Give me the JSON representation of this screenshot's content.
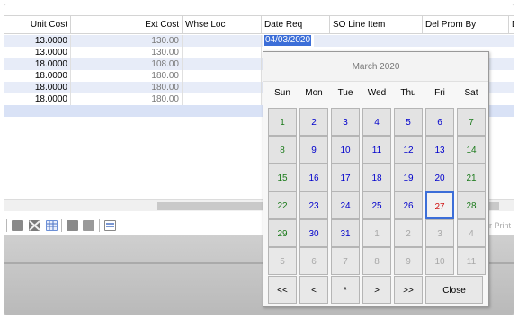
{
  "grid": {
    "columns": [
      "Unit Cost",
      "Ext Cost",
      "Whse Loc",
      "Date Req",
      "SO Line Item",
      "Del Prom By",
      "D"
    ],
    "rows": [
      {
        "unit": "13.0000",
        "ext": "130.00"
      },
      {
        "unit": "13.0000",
        "ext": "130.00"
      },
      {
        "unit": "18.0000",
        "ext": "108.00"
      },
      {
        "unit": "18.0000",
        "ext": "180.00"
      },
      {
        "unit": "18.0000",
        "ext": "180.00"
      },
      {
        "unit": "18.0000",
        "ext": "180.00"
      }
    ],
    "date_value": "04/03/2020"
  },
  "toolbar": {
    "icons": [
      "record-icon",
      "collapse-icon",
      "calendar-grid-icon",
      "comment-icon",
      "note-icon",
      "list-icon"
    ],
    "print_label": "or Print"
  },
  "calendar": {
    "title": "March 2020",
    "weekdays": [
      "Sun",
      "Mon",
      "Tue",
      "Wed",
      "Thu",
      "Fri",
      "Sat"
    ],
    "weeks": [
      [
        "1",
        "2",
        "3",
        "4",
        "5",
        "6",
        "7"
      ],
      [
        "8",
        "9",
        "10",
        "11",
        "12",
        "13",
        "14"
      ],
      [
        "15",
        "16",
        "17",
        "18",
        "19",
        "20",
        "21"
      ],
      [
        "22",
        "23",
        "24",
        "25",
        "26",
        "27",
        "28"
      ],
      [
        "29",
        "30",
        "31",
        "1",
        "2",
        "3",
        "4"
      ],
      [
        "5",
        "6",
        "7",
        "8",
        "9",
        "10",
        "11"
      ]
    ],
    "today": "27",
    "nav": {
      "prev_year": "<<",
      "prev_month": "<",
      "current": "*",
      "next_month": ">",
      "next_year": ">>",
      "close": "Close"
    }
  }
}
